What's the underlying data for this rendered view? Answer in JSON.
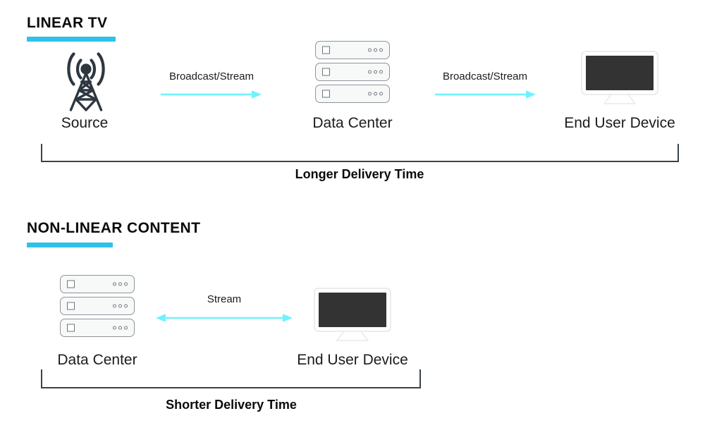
{
  "palette": {
    "heading_rule": "#2ec1e9",
    "arrow": "#6ff2fd",
    "bracket": "#39434b",
    "screen": "#333333",
    "server_body": "#f7f8f8",
    "server_stroke": "#8d949b",
    "tower": "#2e3740",
    "text": "#1a1a1a"
  },
  "sections": [
    {
      "heading": "LINEAR TV",
      "nodes": [
        {
          "label": "Source",
          "icon": "broadcast-tower-icon"
        },
        {
          "label": "Data Center",
          "icon": "server-rack-icon"
        },
        {
          "label": "End User Device",
          "icon": "monitor-icon"
        }
      ],
      "edges": [
        {
          "label": "Broadcast/Stream",
          "direction": "right"
        },
        {
          "label": "Broadcast/Stream",
          "direction": "right"
        }
      ],
      "bracket_caption": "Longer Delivery Time"
    },
    {
      "heading": "NON-LINEAR CONTENT",
      "nodes": [
        {
          "label": "Data Center",
          "icon": "server-rack-icon"
        },
        {
          "label": "End User Device",
          "icon": "monitor-icon"
        }
      ],
      "edges": [
        {
          "label": "Stream",
          "direction": "both"
        }
      ],
      "bracket_caption": "Shorter Delivery Time"
    }
  ]
}
